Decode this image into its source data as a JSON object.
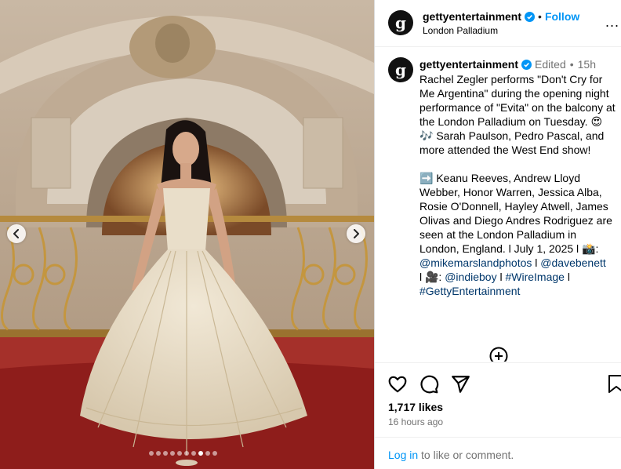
{
  "post": {
    "author": "gettyentertainment",
    "avatar_letter": "g",
    "location": "London Palladium",
    "follow_label": "Follow",
    "header_separator": "•",
    "more_label": "...",
    "edited_label": "Edited",
    "dot_separator": "•",
    "age": "15h",
    "caption_main": "Rachel Zegler performs \"Don't Cry for Me Argentina\" during the opening night performance of \"Evita\" on the balcony at the London Palladium on Tuesday. 😍 🎶 Sarah Paulson, Pedro Pascal, and more attended the West End show!",
    "caption_people": "➡️ Keanu Reeves, Andrew Lloyd Webber, Honor Warren, Jessica Alba, Rosie O'Donnell, Hayley Atwell, James Olivas and Diego Andres Rodriguez are seen at the London Palladium in London, England. l July 1, 2025 l 📸:",
    "credit_photo": "@mikemarslandphotos",
    "credit_sep1": " l ",
    "credit_photo2": "@davebenett",
    "credit_video_prefix": "l 🎥: ",
    "credit_video": "@indieboy",
    "credit_sep2": " l ",
    "tag1": "#WireImage",
    "credit_sep3": " l",
    "tag2": "#GettyEntertainment",
    "likes": "1,717 likes",
    "timestamp": "16 hours ago",
    "login_link": "Log in",
    "login_rest": " to like or comment."
  },
  "carousel": {
    "total_slides": 10,
    "active_index": 7
  },
  "colors": {
    "link_blue": "#0095f6",
    "mention": "#00376b",
    "verified": "#0095f6",
    "carpet": "#8e1d1b"
  },
  "icons": [
    "chevron-left-icon",
    "chevron-right-icon",
    "verified-badge-icon",
    "more-icon",
    "add-comment-icon",
    "heart-icon",
    "comment-icon",
    "share-icon",
    "bookmark-icon"
  ]
}
